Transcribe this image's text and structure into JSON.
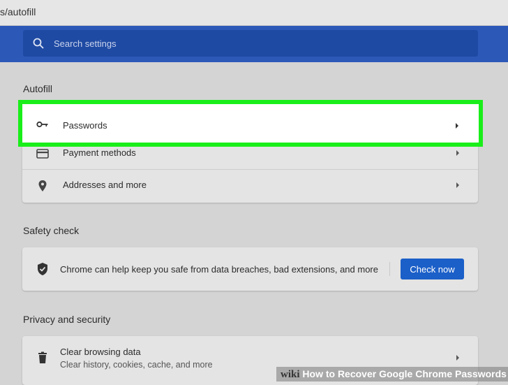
{
  "browser": {
    "url_fragment": "s/autofill"
  },
  "search": {
    "placeholder": "Search settings"
  },
  "autofill": {
    "title": "Autofill",
    "items": [
      {
        "label": "Passwords",
        "icon": "key-icon"
      },
      {
        "label": "Payment methods",
        "icon": "credit-card-icon"
      },
      {
        "label": "Addresses and more",
        "icon": "location-pin-icon"
      }
    ]
  },
  "safety": {
    "title": "Safety check",
    "description": "Chrome can help keep you safe from data breaches, bad extensions, and more",
    "button_label": "Check now",
    "icon": "shield-check-icon"
  },
  "privacy": {
    "title": "Privacy and security",
    "items": [
      {
        "label": "Clear browsing data",
        "sublabel": "Clear history, cookies, cache, and more",
        "icon": "trash-icon"
      }
    ]
  },
  "watermark": {
    "prefix": "wiki",
    "text": "How to Recover Google Chrome Passwords"
  },
  "colors": {
    "header_blue": "#2c58b8",
    "button_blue": "#1b5fc8",
    "highlight_green": "#1aee1a"
  }
}
